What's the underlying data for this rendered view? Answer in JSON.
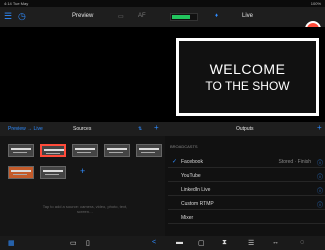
{
  "statusbar": {
    "left": "4:14 Tue May",
    "right": "100%"
  },
  "topbar": {
    "preview_label": "Preview",
    "live_label": "Live",
    "af_label": "AF"
  },
  "live_screen": {
    "line1": "WELCOME",
    "line2": "TO THE SHOW"
  },
  "midbar": {
    "preview_live_label": "Preview → Live",
    "sources_label": "Sources",
    "outputs_label": "Outputs"
  },
  "sources": {
    "hint": "Tap to add a source: camera, video, photo, text, screen…"
  },
  "outputs": {
    "section_label": "BROADCASTS",
    "items": [
      {
        "label": "Facebook",
        "status": "Stored · Finish"
      },
      {
        "label": "YouTube",
        "status": ""
      },
      {
        "label": "LinkedIn Live",
        "status": ""
      },
      {
        "label": "Custom RTMP",
        "status": ""
      },
      {
        "label": "Mixer",
        "status": ""
      }
    ]
  },
  "colors": {
    "accent": "#2f8cff",
    "record": "#ff4b3a",
    "meter": "#22c55e"
  }
}
